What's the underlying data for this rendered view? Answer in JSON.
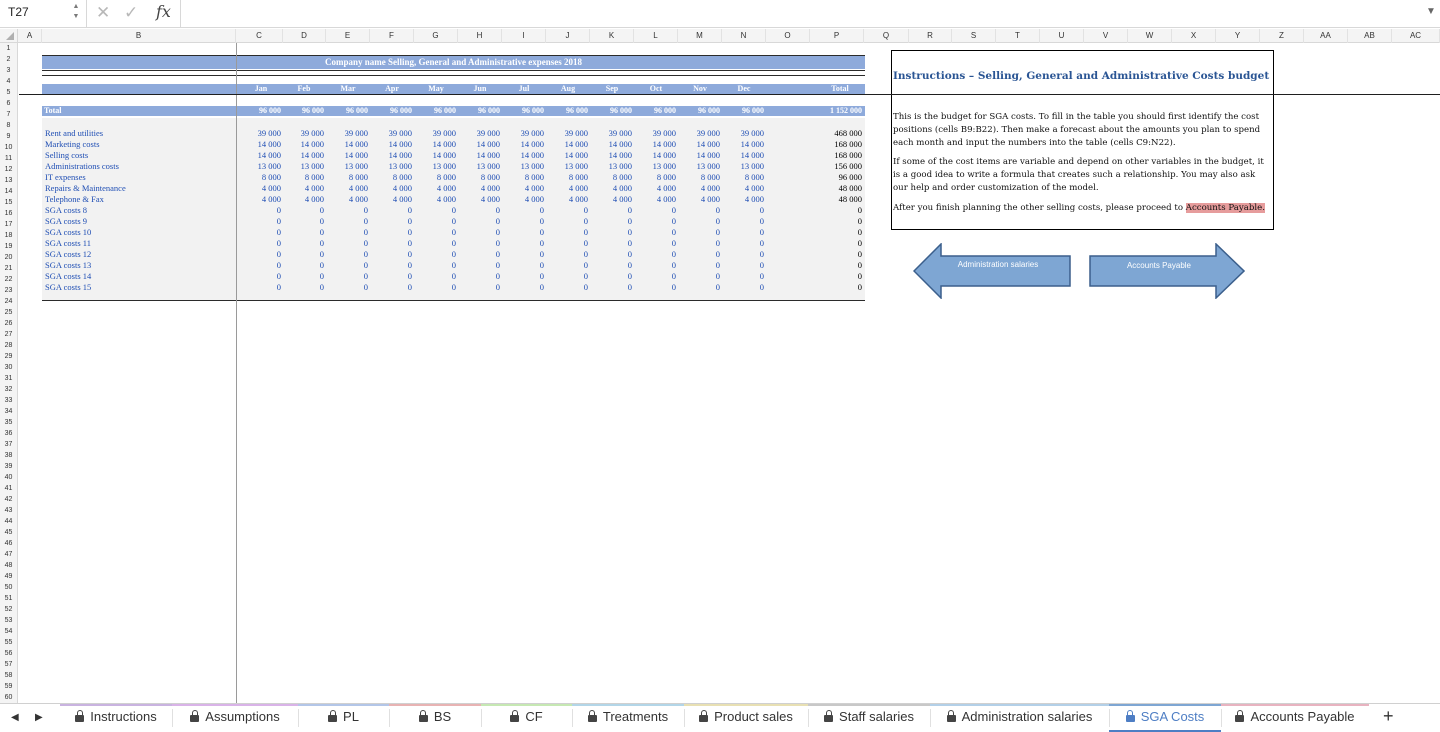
{
  "formula_bar": {
    "cell_ref": "T27",
    "fx_label": "fx",
    "formula": ""
  },
  "columns": [
    "A",
    "B",
    "C",
    "D",
    "E",
    "F",
    "G",
    "H",
    "I",
    "J",
    "K",
    "L",
    "M",
    "N",
    "O",
    "P",
    "Q",
    "R",
    "S",
    "T",
    "U",
    "V",
    "W",
    "X",
    "Y",
    "Z",
    "AA",
    "AB",
    "AC"
  ],
  "sheet": {
    "title": "Company name Selling, General and Administrative expenses 2018",
    "months": [
      "Jan",
      "Feb",
      "Mar",
      "Apr",
      "May",
      "Jun",
      "Jul",
      "Aug",
      "Sep",
      "Oct",
      "Nov",
      "Dec"
    ],
    "total_header": "Total",
    "total_label": "Total",
    "monthly_totals": [
      "96 000",
      "96 000",
      "96 000",
      "96 000",
      "96 000",
      "96 000",
      "96 000",
      "96 000",
      "96 000",
      "96 000",
      "96 000",
      "96 000"
    ],
    "grand_total": "1 152 000",
    "rows": [
      {
        "label": "Rent and utilities",
        "value": "39 000",
        "total": "468 000"
      },
      {
        "label": "Marketing costs",
        "value": "14 000",
        "total": "168 000"
      },
      {
        "label": "Selling costs",
        "value": "14 000",
        "total": "168 000"
      },
      {
        "label": "Administrations costs",
        "value": "13 000",
        "total": "156 000"
      },
      {
        "label": "IT expenses",
        "value": "8 000",
        "total": "96 000"
      },
      {
        "label": "Repairs & Maintenance",
        "value": "4 000",
        "total": "48 000"
      },
      {
        "label": "Telephone & Fax",
        "value": "4 000",
        "total": "48 000"
      },
      {
        "label": "SGA costs 8",
        "value": "0",
        "total": "0"
      },
      {
        "label": "SGA costs 9",
        "value": "0",
        "total": "0"
      },
      {
        "label": "SGA costs 10",
        "value": "0",
        "total": "0"
      },
      {
        "label": "SGA costs 11",
        "value": "0",
        "total": "0"
      },
      {
        "label": "SGA costs 12",
        "value": "0",
        "total": "0"
      },
      {
        "label": "SGA costs 13",
        "value": "0",
        "total": "0"
      },
      {
        "label": "SGA costs 14",
        "value": "0",
        "total": "0"
      },
      {
        "label": "SGA costs 15",
        "value": "0",
        "total": "0"
      }
    ]
  },
  "instructions": {
    "title": "Instructions – Selling, General and Administrative Costs budget",
    "p1": "This is the budget for SGA costs. To fill in the table you should first identify the cost positions (cells B9:B22). Then make a forecast about the amounts you plan to spend each month and input the numbers into the table (cells C9:N22).",
    "p2": "If some of the cost items are variable and depend on other variables in the budget, it is a good idea to write a formula that creates such a relationship. You may also ask our help and order customization of the model.",
    "p3_pre": "After you finish planning the other selling costs, please proceed to ",
    "p3_link": "Accounts Payable.",
    "highlight_color": "#e69c9c"
  },
  "nav_arrows": {
    "left_label": "Administration salaries",
    "right_label": "Accounts Payable",
    "fill": "#7ea6d3",
    "stroke": "#3b5f8c"
  },
  "tabs": [
    {
      "label": "Instructions",
      "stripe": "#c9b3e0"
    },
    {
      "label": "Assumptions",
      "stripe": "#d9b3e8"
    },
    {
      "label": "PL",
      "stripe": "#b3c6e8"
    },
    {
      "label": "BS",
      "stripe": "#e8b3b3"
    },
    {
      "label": "CF",
      "stripe": "#c6e8b3"
    },
    {
      "label": "Treatments",
      "stripe": "#b3d6e8"
    },
    {
      "label": "Product sales",
      "stripe": "#e8e0b3"
    },
    {
      "label": "Staff salaries",
      "stripe": "#c8c8c8"
    },
    {
      "label": "Administration salaries",
      "stripe": "#b3d0e8"
    },
    {
      "label": "SGA Costs",
      "stripe": "#7ea6d3"
    },
    {
      "label": "Accounts Payable",
      "stripe": "#e8b3c0"
    }
  ],
  "active_tab": "SGA Costs",
  "colors": {
    "header_band": "#8eaadb",
    "value_text": "#1f4eb4",
    "accent": "#4e7ec4"
  }
}
